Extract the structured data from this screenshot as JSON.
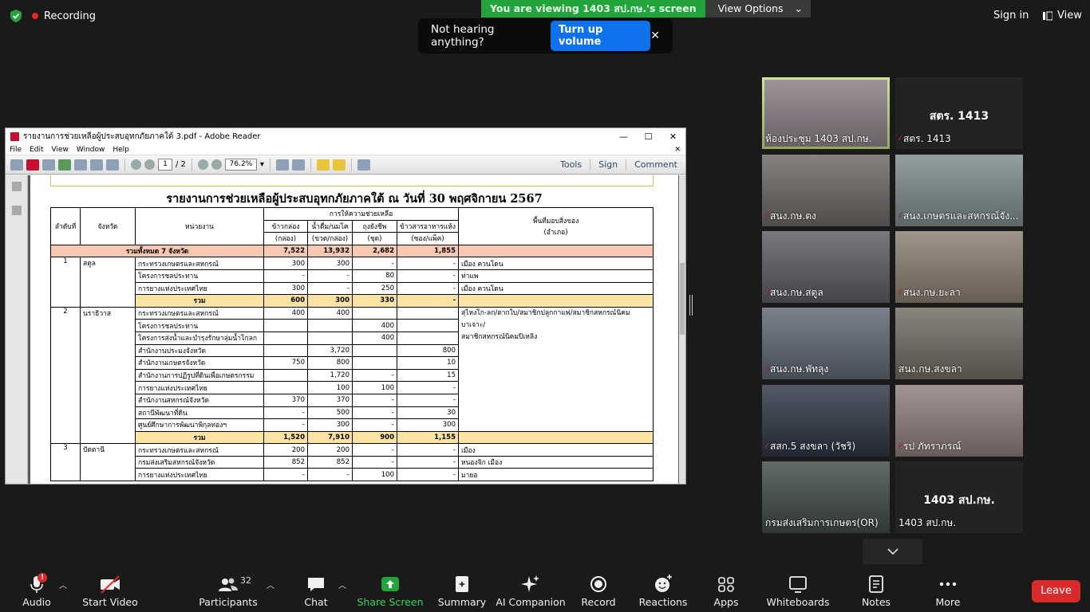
{
  "top": {
    "recording": "Recording",
    "viewing_banner": "You are viewing 1403 สป.กษ.'s screen",
    "view_options": "View Options",
    "toast_text": "Not hearing anything?",
    "toast_button": "Turn up volume",
    "sign_in": "Sign in",
    "view": "View"
  },
  "adobe": {
    "title": "รายงานการช่วยเหลือผู้ประสบอุทกภัยภาคใต้ 3.pdf - Adobe Reader",
    "menu": [
      "File",
      "Edit",
      "View",
      "Window",
      "Help"
    ],
    "page_num": "1",
    "page_total": "/ 2",
    "zoom": "76.2%",
    "tools": "Tools",
    "sign": "Sign",
    "comment": "Comment"
  },
  "report": {
    "title": "รายงานการช่วยเหลือผู้ประสบอุทกภัยภาคใต้ ณ วันที่ 30 พฤศจิกายน 2567",
    "headers": {
      "no": "ลำดับที่",
      "province": "จังหวัด",
      "agency": "หน่วยงาน",
      "group": "การให้ความช่วยเหลือ",
      "c1": "ข้าวกล่อง",
      "c1u": "(กล่อง)",
      "c2": "น้ำดื่ม/นมโค",
      "c2u": "(ขวด/กล่อง)",
      "c3": "ถุงยังชีพ",
      "c3u": "(ชุด)",
      "c4": "ข้าวสารอาหารแห้ง",
      "c4u": "(ซอง/แพ็ค)",
      "area": "พื้นที่มอบสิ่งของ",
      "areau": "(อำเภอ)"
    },
    "total": {
      "label": "รวมทั้งหมด 7 จังหวัด",
      "c1": "7,522",
      "c2": "13,932",
      "c3": "2,682",
      "c4": "1,855"
    },
    "sum_label": "รวม",
    "satun": {
      "no": "1",
      "name": "สตูล",
      "rows": [
        {
          "agency": "กระทรวงเกษตรและสหกรณ์",
          "c1": "300",
          "c2": "300",
          "c3": "-",
          "c4": "-",
          "area": "เมือง ควนโดน"
        },
        {
          "agency": "โครงการชลประทาน",
          "c1": "-",
          "c2": "-",
          "c3": "80",
          "c4": "-",
          "area": "ท่าแพ"
        },
        {
          "agency": "การยางแห่งประเทศไทย",
          "c1": "300",
          "c2": "-",
          "c3": "250",
          "c4": "-",
          "area": "เมือง ควนโดน"
        }
      ],
      "sum": {
        "c1": "600",
        "c2": "300",
        "c3": "330",
        "c4": "-"
      }
    },
    "nara": {
      "no": "2",
      "name": "นราธิวาส",
      "area1": "สุไหงโก-ลก/ตากใบ/สมาชิกปลูกกาแฟ/สมาชิกสหกรณ์นิคมบาเจาะ/",
      "area2": "สมาชิกสหกรณ์นิคมปิเหลิง",
      "rows": [
        {
          "agency": "กระทรวงเกษตรและสหกรณ์",
          "c1": "400",
          "c2": "400",
          "c3": "",
          "c4": ""
        },
        {
          "agency": "โครงการชลประทาน",
          "c1": "",
          "c2": "",
          "c3": "400",
          "c4": ""
        },
        {
          "agency": "โครงการส่งน้ำและบำรุงรักษาลุ่มน้ำโกลก",
          "c1": "",
          "c2": "",
          "c3": "400",
          "c4": ""
        },
        {
          "agency": "สำนักงานประมงจังหวัด",
          "c1": "",
          "c2": "3,720",
          "c3": "",
          "c4": "800"
        },
        {
          "agency": "สำนักงานเกษตรจังหวัด",
          "c1": "750",
          "c2": "800",
          "c3": "",
          "c4": "10"
        },
        {
          "agency": "สำนักงานการปฏิรูปที่ดินเพื่อเกษตรกรรม",
          "c1": "",
          "c2": "1,720",
          "c3": "-",
          "c4": "15"
        },
        {
          "agency": "การยางแห่งประเทศไทย",
          "c1": "",
          "c2": "100",
          "c3": "100",
          "c4": "-"
        },
        {
          "agency": "สำนักงานสหกรณ์จังหวัด",
          "c1": "370",
          "c2": "370",
          "c3": "-",
          "c4": "-"
        },
        {
          "agency": "สถานีพัฒนาที่ดิน",
          "c1": "-",
          "c2": "500",
          "c3": "-",
          "c4": "30"
        },
        {
          "agency": "ศูนย์ศึกษาการพัฒนาพิกุลทองฯ",
          "c1": "-",
          "c2": "300",
          "c3": "-",
          "c4": "300"
        }
      ],
      "sum": {
        "c1": "1,520",
        "c2": "7,910",
        "c3": "900",
        "c4": "1,155"
      }
    },
    "pattani": {
      "no": "3",
      "name": "ปัตตานี",
      "rows": [
        {
          "agency": "กระทรวงเกษตรและสหกรณ์",
          "c1": "200",
          "c2": "200",
          "c3": "-",
          "c4": "-",
          "area": "เมือง"
        },
        {
          "agency": "กรมส่งเสริมสหกรณ์จังหวัด",
          "c1": "852",
          "c2": "852",
          "c3": "-",
          "c4": "-",
          "area": "หนองจิก เมือง"
        },
        {
          "agency": "การยางแห่งประเทศไทย",
          "c1": "-",
          "c2": "-",
          "c3": "100",
          "c4": "-",
          "area": "มายอ"
        }
      ]
    }
  },
  "gallery": [
    {
      "name": "ห้องประชุม 1403 สป.กษ.",
      "muted": false,
      "big": "",
      "bg": "#8a7f86"
    },
    {
      "name": "สตร. 1413",
      "muted": true,
      "big": "สตร. 1413",
      "bg": "#232323"
    },
    {
      "name": "สนง.กษ.ตง",
      "muted": true,
      "big": "",
      "bg": "#6b6664"
    },
    {
      "name": "สนง.เกษตรและสหกรณ์จัง...",
      "muted": true,
      "big": "",
      "bg": "#7c8a8a"
    },
    {
      "name": "สนง.กษ.สตูล",
      "muted": true,
      "big": "",
      "bg": "#5d5a63"
    },
    {
      "name": "สนง.กษ.ยะลา",
      "muted": true,
      "big": "",
      "bg": "#8a7d70"
    },
    {
      "name": "สนง.กษ.พัทลุง",
      "muted": true,
      "big": "",
      "bg": "#5e6673"
    },
    {
      "name": "สนง.กษ.สงขลา",
      "muted": false,
      "big": "",
      "bg": "#706a60"
    },
    {
      "name": "สสก.5 สงขลา (วัชริ)",
      "muted": true,
      "big": "",
      "bg": "#2d3444"
    },
    {
      "name": "รป ภัทราภรณ์",
      "muted": true,
      "big": "",
      "bg": "#8d7c7a"
    },
    {
      "name": "กรมส่งเสริมการเกษตร(OR)",
      "muted": false,
      "big": "",
      "bg": "#3f4a45"
    },
    {
      "name": "1403 สป.กษ.",
      "muted": false,
      "big": "1403 สป.กษ.",
      "bg": "#232323"
    }
  ],
  "toolbar": {
    "audio": "Audio",
    "audio_badge": "!",
    "video": "Start Video",
    "participants": "Participants",
    "participants_count": "32",
    "chat": "Chat",
    "share": "Share Screen",
    "summary": "Summary",
    "ai": "AI Companion",
    "record": "Record",
    "reactions": "Reactions",
    "apps": "Apps",
    "whiteboards": "Whiteboards",
    "notes": "Notes",
    "more": "More",
    "leave": "Leave"
  },
  "colors": {
    "share_green": "#22a33b",
    "leave_red": "#d92b2b",
    "zoom_blue": "#0e72ed",
    "active_outline": "#c1e37c"
  }
}
